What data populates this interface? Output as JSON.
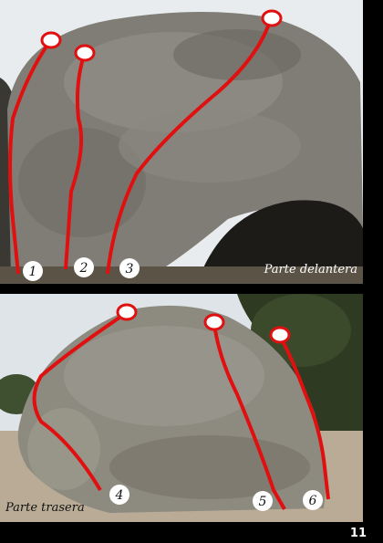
{
  "top_photo": {
    "caption": "Parte delantera",
    "routes": [
      {
        "number": "1"
      },
      {
        "number": "2"
      },
      {
        "number": "3"
      }
    ]
  },
  "bottom_photo": {
    "caption": "Parte trasera",
    "routes": [
      {
        "number": "4"
      },
      {
        "number": "5"
      },
      {
        "number": "6"
      }
    ]
  },
  "page_number": "11",
  "colors": {
    "route_line": "#e01010",
    "marker_fill": "#ffffff",
    "background": "#000000"
  }
}
